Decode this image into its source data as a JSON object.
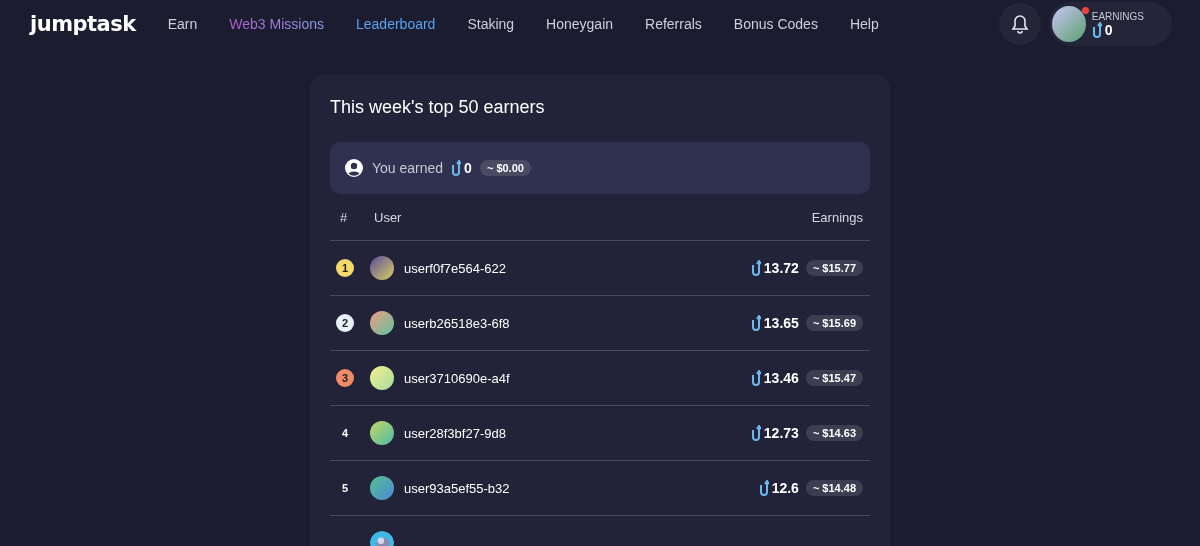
{
  "logo": "jumptask",
  "nav": [
    {
      "label": "Earn",
      "kind": "plain",
      "selected": false
    },
    {
      "label": "Web3 Missions",
      "kind": "gradient",
      "selected": false
    },
    {
      "label": "Leaderboard",
      "kind": "plain",
      "selected": true
    },
    {
      "label": "Staking",
      "kind": "plain",
      "selected": false
    },
    {
      "label": "Honeygain",
      "kind": "plain",
      "selected": false
    },
    {
      "label": "Referrals",
      "kind": "plain",
      "selected": false
    },
    {
      "label": "Bonus Codes",
      "kind": "plain",
      "selected": false
    },
    {
      "label": "Help",
      "kind": "plain",
      "selected": false
    }
  ],
  "account": {
    "notification": true,
    "earnings_label": "EARNINGS",
    "earnings": "0"
  },
  "leaderboard": {
    "title": "This week's top 50 earners",
    "you": {
      "label": "You earned",
      "amount": "0",
      "usd": "~ $0.00"
    },
    "columns": [
      "#",
      "User",
      "Earnings"
    ],
    "rows": [
      {
        "rank": "1",
        "color": "#f7d96a",
        "user": "userf0f7e564-622",
        "amount": "13.72",
        "usd": "~ $15.77"
      },
      {
        "rank": "2",
        "color": "#e6f0fb",
        "user": "userb26518e3-6f8",
        "amount": "13.65",
        "usd": "~ $15.69"
      },
      {
        "rank": "3",
        "color": "#f18a68",
        "user": "user3710690e-a4f",
        "amount": "13.46",
        "usd": "~ $15.47"
      },
      {
        "rank": "4",
        "user": "user28f3bf27-9d8",
        "amount": "12.73",
        "usd": "~ $14.63"
      },
      {
        "rank": "5",
        "user": "user93a5ef55-b32",
        "amount": "12.6",
        "usd": "~ $14.48"
      },
      {
        "kind": "picture"
      }
    ]
  }
}
